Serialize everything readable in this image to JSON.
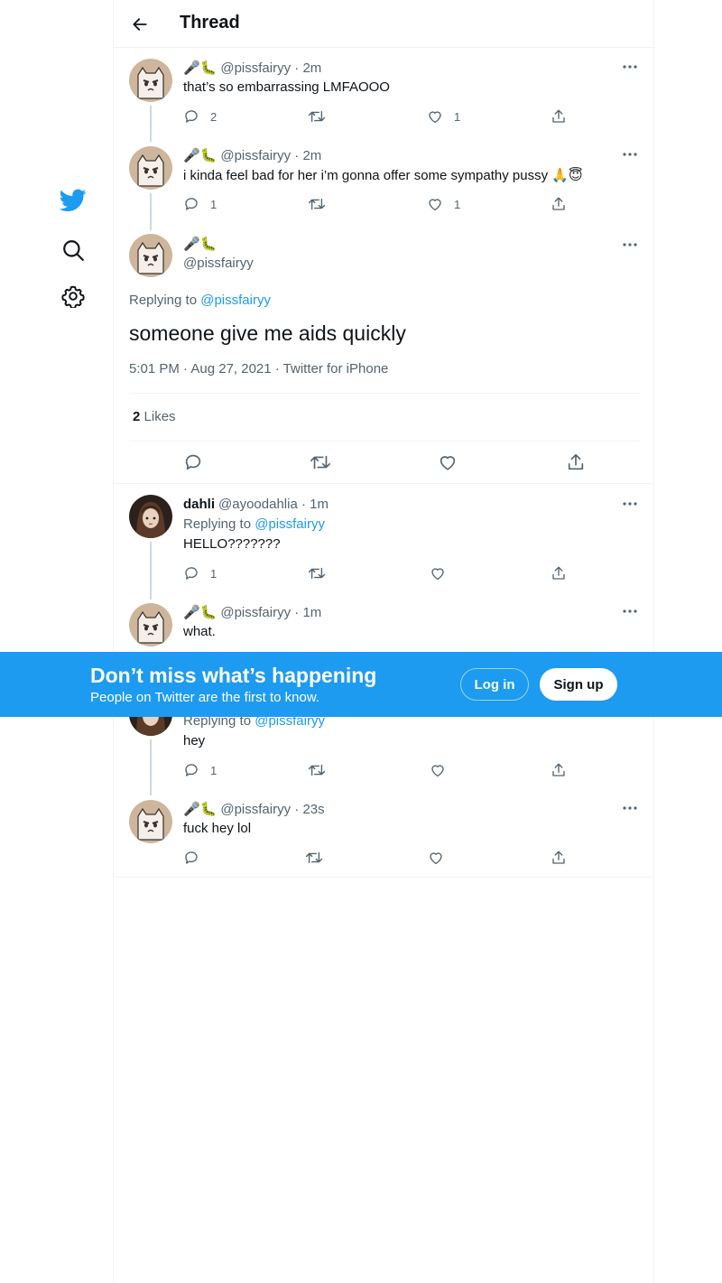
{
  "header": {
    "title": "Thread"
  },
  "colors": {
    "accent": "#1d9bf0",
    "text": "#0f1419",
    "muted": "#536471",
    "border": "#eff3f4"
  },
  "tweets": [
    {
      "emoji": "🎤🐛",
      "handle": "@pissfairyy",
      "time": "· 2m",
      "text": "that’s so embarrassing LMFAOOO",
      "replies": "2",
      "retweets": "",
      "likes": "1"
    },
    {
      "emoji": "🎤🐛",
      "handle": "@pissfairyy",
      "time": "· 2m",
      "text": "i kinda feel bad for her i’m gonna offer some sympathy pussy 🙏😇",
      "replies": "1",
      "retweets": "",
      "likes": "1"
    },
    {
      "name": "dahli",
      "handle": "@ayoodahlia",
      "time": "· 1m",
      "replying_label": "Replying to",
      "replying_to": "@pissfairyy",
      "text": "HELLO???????",
      "replies": "1",
      "retweets": "",
      "likes": ""
    },
    {
      "emoji": "🎤🐛",
      "handle": "@pissfairyy",
      "time": "· 1m",
      "text": "what."
    },
    {
      "replying_label": "Replying to",
      "replying_to": "@pissfairyy",
      "text": "hey",
      "replies": "1",
      "retweets": "",
      "likes": ""
    },
    {
      "emoji": "🎤🐛",
      "handle": "@pissfairyy",
      "time": "· 23s",
      "text": "fuck hey lol",
      "replies": "",
      "retweets": "",
      "likes": ""
    }
  ],
  "main_tweet": {
    "emoji": "🎤🐛",
    "handle": "@pissfairyy",
    "replying_label": "Replying to",
    "replying_to": "@pissfairyy",
    "text": "someone give me aids quickly",
    "timestamp": "5:01 PM · Aug 27, 2021 · Twitter for iPhone",
    "likes_count": "2",
    "likes_label": "Likes"
  },
  "banner": {
    "title": "Don’t miss what’s happening",
    "subtitle": "People on Twitter are the first to know.",
    "login": "Log in",
    "signup": "Sign up"
  },
  "icons": [
    "twitter-logo-icon",
    "search-icon",
    "settings-icon",
    "back-arrow-icon",
    "more-icon",
    "reply-icon",
    "retweet-icon",
    "like-icon",
    "share-icon"
  ]
}
